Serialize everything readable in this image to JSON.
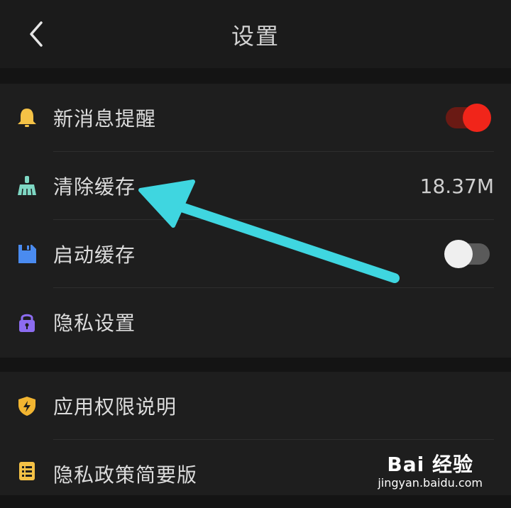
{
  "header": {
    "title": "设置"
  },
  "group1": {
    "items": [
      {
        "label": "新消息提醒",
        "icon": "bell-icon",
        "toggle": "on"
      },
      {
        "label": "清除缓存",
        "icon": "broom-icon",
        "value": "18.37M"
      },
      {
        "label": "启动缓存",
        "icon": "save-icon",
        "toggle": "off"
      },
      {
        "label": "隐私设置",
        "icon": "lock-icon"
      }
    ]
  },
  "group2": {
    "items": [
      {
        "label": "应用权限说明",
        "icon": "shield-icon"
      },
      {
        "label": "隐私政策简要版",
        "icon": "document-icon"
      }
    ]
  },
  "watermark": {
    "logo": "Bai 经验",
    "url": "jingyan.baidu.com"
  },
  "colors": {
    "background": "#141414",
    "card": "#1e1e1e",
    "toggle_on": "#f1251a",
    "annotation_arrow": "#3fd6e0",
    "bell": "#f5c246",
    "broom": "#7fd8c4",
    "save": "#4a8bf0",
    "lock": "#8c6cf0",
    "shield": "#f2b531"
  }
}
